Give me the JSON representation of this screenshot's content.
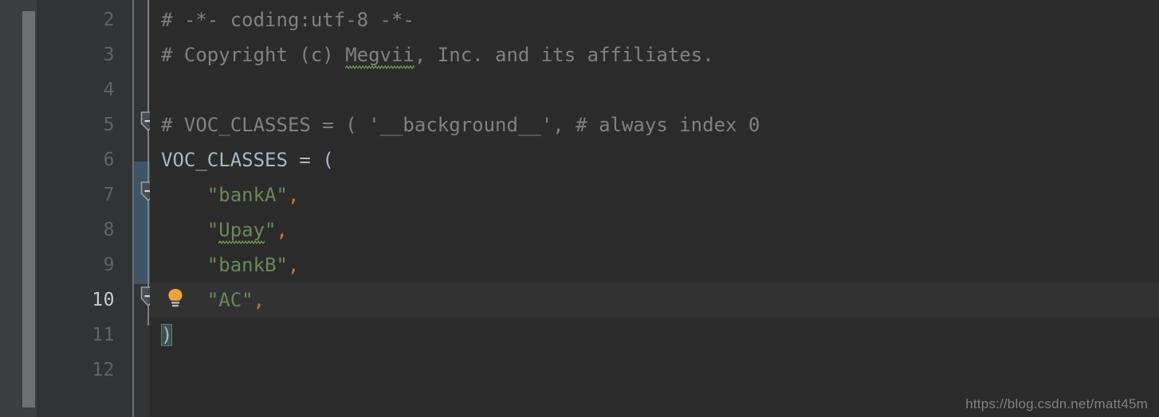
{
  "editor": {
    "background_color": "#2b2b2b",
    "gutter_color": "#313335",
    "current_line_color": "#323232",
    "fold_band_color": "#3e5567",
    "scrollbar_thumb_color": "#6e7173",
    "scrollbar_track_color": "#3c3f41",
    "current_line_number": 10,
    "first_visible_line": 2,
    "last_visible_line": 12,
    "line_height_px": 44
  },
  "line_numbers": [
    2,
    3,
    4,
    5,
    6,
    7,
    8,
    9,
    10,
    11,
    12
  ],
  "lines": [
    {
      "number": 2,
      "text": "# -*- coding:utf-8 -*-",
      "tokens": [
        {
          "kind": "comment",
          "text": "# -*- coding:utf-8 -*-"
        }
      ]
    },
    {
      "number": 3,
      "text": "# Copyright (c) Megvii, Inc. and its affiliates.",
      "tokens": [
        {
          "kind": "comment",
          "text": "# Copyright (c) "
        },
        {
          "kind": "comment-misspelled",
          "text": "Megvii"
        },
        {
          "kind": "comment",
          "text": ", Inc. and its affiliates."
        }
      ]
    },
    {
      "number": 4,
      "text": "",
      "tokens": []
    },
    {
      "number": 5,
      "text": "# VOC_CLASSES = ( '__background__', # always index 0",
      "tokens": [
        {
          "kind": "comment",
          "text": "# VOC_CLASSES = ( '__background__', # always index 0"
        }
      ]
    },
    {
      "number": 6,
      "text": "VOC_CLASSES = (",
      "tokens": [
        {
          "kind": "ident",
          "text": "VOC_CLASSES"
        },
        {
          "kind": "op",
          "text": " = "
        },
        {
          "kind": "paren",
          "text": "("
        }
      ]
    },
    {
      "number": 7,
      "text": "    \"bankA\",",
      "tokens": [
        {
          "kind": "plain",
          "text": "    "
        },
        {
          "kind": "string",
          "text": "\"bankA\""
        },
        {
          "kind": "comma",
          "text": ","
        }
      ]
    },
    {
      "number": 8,
      "text": "    \"Upay\",",
      "tokens": [
        {
          "kind": "plain",
          "text": "    "
        },
        {
          "kind": "string",
          "text": "\""
        },
        {
          "kind": "string-misspelled",
          "text": "Upay"
        },
        {
          "kind": "string",
          "text": "\""
        },
        {
          "kind": "comma",
          "text": ","
        }
      ]
    },
    {
      "number": 9,
      "text": "    \"bankB\",",
      "tokens": [
        {
          "kind": "plain",
          "text": "    "
        },
        {
          "kind": "string",
          "text": "\"bankB\""
        },
        {
          "kind": "comma",
          "text": ","
        }
      ]
    },
    {
      "number": 10,
      "text": "    \"AC\",",
      "tokens": [
        {
          "kind": "plain",
          "text": "    "
        },
        {
          "kind": "string",
          "text": "\"AC\""
        },
        {
          "kind": "comma",
          "text": ","
        }
      ]
    },
    {
      "number": 11,
      "text": ")",
      "tokens": [
        {
          "kind": "brace-match",
          "text": ")"
        }
      ]
    },
    {
      "number": 12,
      "text": "",
      "tokens": []
    }
  ],
  "gutter_icons": {
    "fold_markers": [
      {
        "icon": "fold-collapse-icon",
        "line": 5
      },
      {
        "icon": "fold-collapse-icon",
        "line": 7
      },
      {
        "icon": "fold-collapse-icon",
        "line": 10
      }
    ],
    "intention_bulb": {
      "icon": "lightbulb-icon",
      "line": 10,
      "color": "#eda33c"
    }
  },
  "colors": {
    "comment": "#808080",
    "identifier": "#a9b7c6",
    "string": "#6a8759",
    "comma": "#cc7832",
    "line_number": "#606366",
    "line_number_current": "#c8cbcc",
    "spellcheck_squiggle": "#6a9955"
  },
  "watermark": {
    "text": "https://blog.csdn.net/matt45m"
  }
}
